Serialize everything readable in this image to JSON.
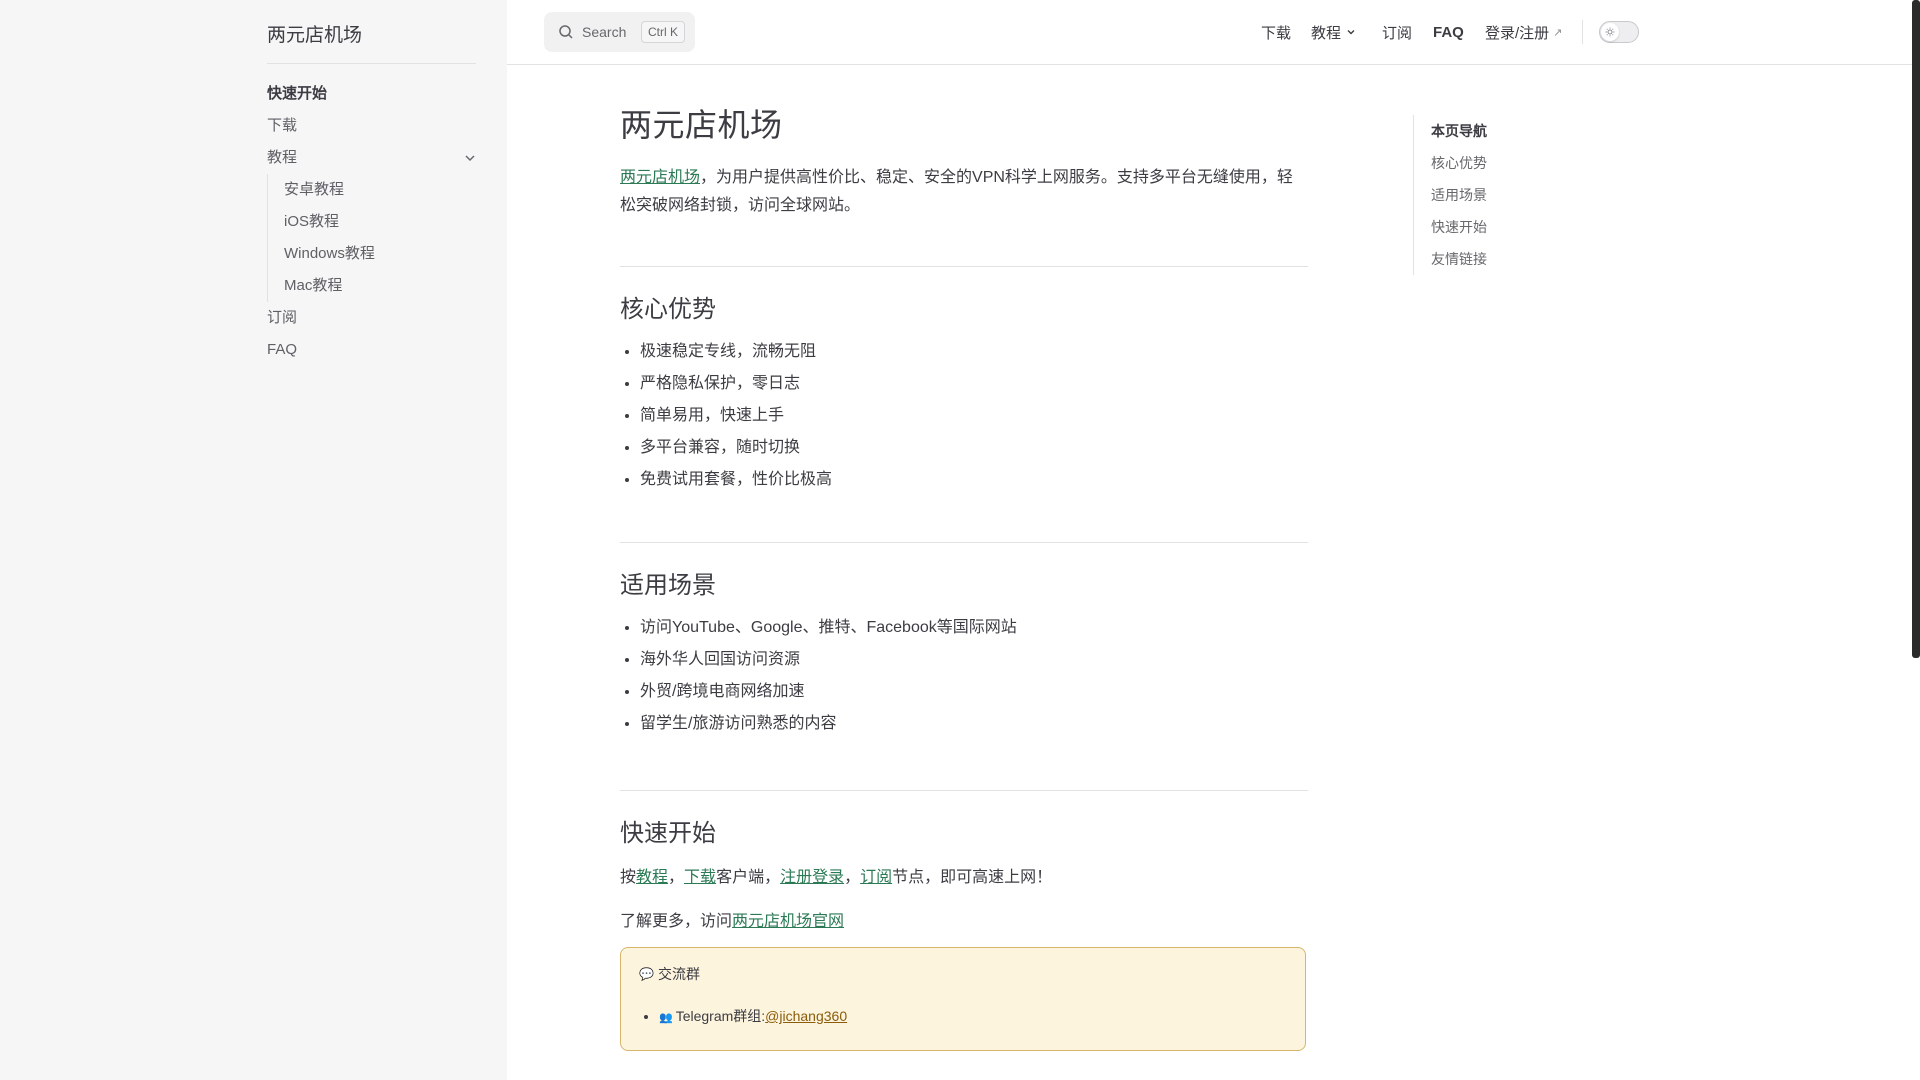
{
  "sidebar": {
    "title": "两元店机场",
    "items": [
      {
        "label": "快速开始"
      },
      {
        "label": "下载"
      },
      {
        "label": "教程"
      },
      {
        "label": "订阅"
      },
      {
        "label": "FAQ"
      }
    ],
    "tutorials": [
      {
        "label": "安卓教程"
      },
      {
        "label": "iOS教程"
      },
      {
        "label": "Windows教程"
      },
      {
        "label": "Mac教程"
      }
    ]
  },
  "header": {
    "search_label": "Search",
    "search_shortcut": "Ctrl K",
    "nav": {
      "download": "下载",
      "tutorial": "教程",
      "subscribe": "订阅",
      "faq": "FAQ",
      "login": "登录/注册"
    }
  },
  "main": {
    "title": "两元店机场",
    "intro_link": "两元店机场",
    "intro_text": "，为用户提供高性价比、稳定、安全的VPN科学上网服务。支持多平台无缝使用，轻松突破网络封锁，访问全球网站。",
    "advantages_title": "核心优势",
    "advantages": [
      "极速稳定专线，流畅无阻",
      "严格隐私保护，零日志",
      "简单易用，快速上手",
      "多平台兼容，随时切换",
      "免费试用套餐，性价比极高"
    ],
    "scenarios_title": "适用场景",
    "scenarios": [
      "访问YouTube、Google、推特、Facebook等国际网站",
      "海外华人回国访问资源",
      "外贸/跨境电商网络加速",
      "留学生/旅游访问熟悉的内容"
    ],
    "quickstart_title": "快速开始",
    "qs_prefix": "按",
    "qs_link1": "教程",
    "qs_sep1": "，",
    "qs_link2": "下载",
    "qs_mid": "客户端，",
    "qs_link3": "注册登录",
    "qs_sep2": "，",
    "qs_link4": "订阅",
    "qs_suffix": "节点，即可高速上网！",
    "more_prefix": "了解更多，访问",
    "more_link": "两元店机场官网",
    "callout": {
      "icon": "💬",
      "title": "交流群",
      "item_icon": "👥",
      "item_text": "Telegram群组:",
      "item_link": "@jichang360"
    }
  },
  "outline": {
    "title": "本页导航",
    "items": [
      "核心优势",
      "适用场景",
      "快速开始",
      "友情链接"
    ]
  }
}
